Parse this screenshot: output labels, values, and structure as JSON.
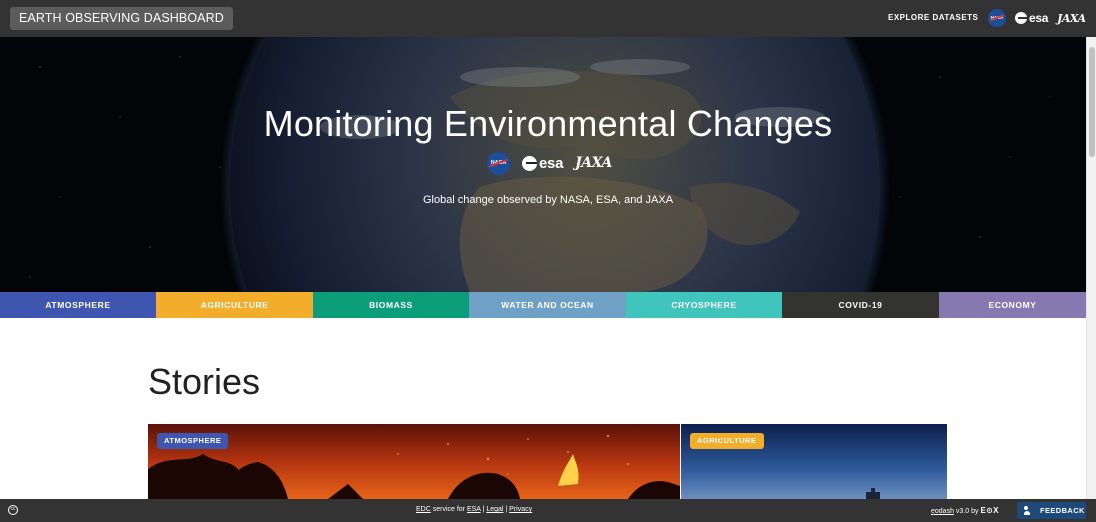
{
  "header": {
    "title": "EARTH OBSERVING DASHBOARD",
    "explore_label": "EXPLORE DATASETS",
    "logos": {
      "nasa": "NASA",
      "esa": "esa",
      "jaxa": "JAXA"
    }
  },
  "hero": {
    "title": "Monitoring Environmental Changes",
    "subtitle": "Global change observed by NASA, ESA, and JAXA",
    "logos": {
      "nasa": "NASA",
      "esa": "esa",
      "jaxa": "JAXA"
    }
  },
  "categories": [
    {
      "label": "ATMOSPHERE",
      "color": "#3f56b0"
    },
    {
      "label": "AGRICULTURE",
      "color": "#f2ae2b"
    },
    {
      "label": "BIOMASS",
      "color": "#0c9e7b"
    },
    {
      "label": "WATER AND OCEAN",
      "color": "#6ea1c5"
    },
    {
      "label": "CRYOSPHERE",
      "color": "#3fc5bc"
    },
    {
      "label": "COVID-19",
      "color": "#33332f"
    },
    {
      "label": "ECONOMY",
      "color": "#8678b0"
    }
  ],
  "stories": {
    "heading": "Stories",
    "items": [
      {
        "badge": "ATMOSPHERE",
        "badge_color": "#3f56b0"
      },
      {
        "badge": "AGRICULTURE",
        "badge_color": "#f2ae2b"
      }
    ]
  },
  "footer": {
    "license_icon": "cc-icon",
    "service_prefix": "EDC",
    "service_mid": " service for ",
    "service_org": "ESA",
    "sep1": " | ",
    "legal": "Legal",
    "sep2": " | ",
    "privacy": "Privacy",
    "version_link": "eodash",
    "version_text": " v3.0 by ",
    "eox": "E⊙X",
    "feedback": "FEEDBACK"
  },
  "colors": {
    "topbar": "#333333",
    "footer": "#333333",
    "feedback_button": "#1e4a7a"
  }
}
